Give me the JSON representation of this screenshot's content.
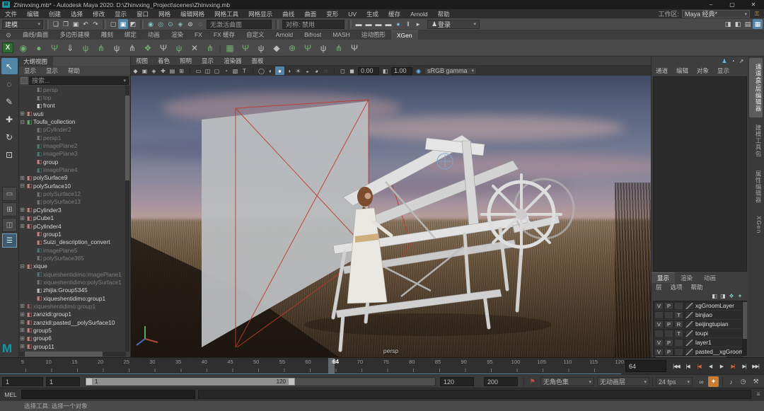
{
  "window": {
    "logo": "M",
    "title": "Zhinvxing.mb* - Autodesk Maya 2020: D:\\Zhinvxing_Project\\scenes\\Zhinvxing.mb",
    "controls": [
      {
        "g": "–"
      },
      {
        "g": "▢"
      },
      {
        "g": "✕"
      }
    ],
    "workspace_label": "工作区:",
    "workspace_value": "Maya 经典*",
    "caret": "▾",
    "lock_icon": "⚿"
  },
  "menubar": {
    "items": [
      {
        "label": "文件"
      },
      {
        "label": "编辑"
      },
      {
        "label": "创建"
      },
      {
        "label": "选择"
      },
      {
        "label": "修改"
      },
      {
        "label": "显示"
      },
      {
        "label": "窗口"
      },
      {
        "label": "网格"
      },
      {
        "label": "编辑网格"
      },
      {
        "label": "网格工具"
      },
      {
        "label": "网格显示"
      },
      {
        "label": "曲线"
      },
      {
        "label": "曲面"
      },
      {
        "label": "变形"
      },
      {
        "label": "UV"
      },
      {
        "label": "生成"
      },
      {
        "label": "缓存"
      },
      {
        "label": "Arnold"
      },
      {
        "label": "帮助"
      }
    ]
  },
  "statusline": {
    "mode": "建模",
    "file_icons": [
      {
        "g": "❏"
      },
      {
        "g": "❐"
      },
      {
        "g": "▣"
      },
      {
        "g": "↶"
      },
      {
        "g": "↷"
      }
    ],
    "selmask_icons": [
      {
        "g": "▢"
      },
      {
        "g": "▣",
        "cls": "act"
      },
      {
        "g": "◩"
      }
    ],
    "snap_icons": [
      {
        "g": "◉",
        "cls": "tl"
      },
      {
        "g": "◎",
        "cls": "tl"
      },
      {
        "g": "⊙",
        "cls": "tl"
      },
      {
        "g": "◈",
        "cls": "tl"
      },
      {
        "g": "⊚"
      },
      {
        "g": "◌"
      }
    ],
    "no_live_surface": "无激活曲面",
    "symmetry": "对称: 禁用",
    "render_icons": [
      {
        "g": "▬"
      },
      {
        "g": "▬"
      },
      {
        "g": "▬"
      },
      {
        "g": "▬"
      },
      {
        "g": "●",
        "cls": "blu"
      },
      {
        "g": "‖"
      },
      {
        "g": "▸"
      }
    ],
    "login_icon": "♟",
    "login": "登录",
    "right_toggles": [
      {
        "g": "◨"
      },
      {
        "g": "◧"
      },
      {
        "g": "▤"
      },
      {
        "g": "▦",
        "cls": "act"
      }
    ]
  },
  "shelf": {
    "gear": "⚙",
    "tabs": [
      {
        "label": "曲线/曲面"
      },
      {
        "label": "多边形建模"
      },
      {
        "label": "雕刻"
      },
      {
        "label": "绑定"
      },
      {
        "label": "动画"
      },
      {
        "label": "渲染"
      },
      {
        "label": "FX"
      },
      {
        "label": "FX 缓存"
      },
      {
        "label": "自定义"
      },
      {
        "label": "Arnold"
      },
      {
        "label": "Bifrost"
      },
      {
        "label": "MASH"
      },
      {
        "label": "运动图形"
      },
      {
        "label": "XGen",
        "cls": "act"
      }
    ],
    "icons": [
      {
        "g": "X",
        "cls": "xgx"
      },
      {
        "g": "◉",
        "cls": "grn"
      },
      {
        "g": "●",
        "cls": "grn"
      },
      {
        "g": "Ψ",
        "cls": "grn"
      },
      {
        "g": "⇓",
        "cls": "gry"
      },
      {
        "g": "ψ",
        "cls": "grn"
      },
      {
        "g": "⋔",
        "cls": "grn"
      },
      {
        "g": "ψ",
        "cls": "gry"
      },
      {
        "g": "⋔",
        "cls": "gry"
      },
      {
        "g": "❖",
        "cls": "grn"
      },
      {
        "g": "Ψ",
        "cls": "gry"
      },
      {
        "g": "ψ",
        "cls": "grn"
      },
      {
        "g": "✕",
        "cls": "gry"
      },
      {
        "g": "⋔",
        "cls": "grn"
      },
      {
        "g": "|",
        "cls": "sp"
      },
      {
        "g": "▦",
        "cls": "grn"
      },
      {
        "g": "Ψ",
        "cls": "grn"
      },
      {
        "g": "ψ",
        "cls": "gry"
      },
      {
        "g": "◆",
        "cls": "gry"
      },
      {
        "g": "⊕",
        "cls": "grn"
      },
      {
        "g": "Ψ",
        "cls": "grn"
      },
      {
        "g": "ψ",
        "cls": "gry"
      },
      {
        "g": "⋔",
        "cls": "grn"
      },
      {
        "g": "Ψ",
        "cls": "gry"
      }
    ]
  },
  "toolbox": {
    "tools": [
      {
        "g": "↖",
        "cls": "act"
      },
      {
        "g": "◌"
      },
      {
        "g": "✎"
      },
      {
        "g": "✚"
      },
      {
        "g": "↻"
      },
      {
        "g": "⊡"
      }
    ],
    "layouts": [
      {
        "g": "▭"
      },
      {
        "g": "⊞"
      },
      {
        "g": "◫"
      },
      {
        "g": "☰",
        "cls": "act"
      }
    ]
  },
  "outliner": {
    "title": "大纲视图",
    "menus": [
      {
        "label": "显示"
      },
      {
        "label": "显示"
      },
      {
        "label": "帮助"
      }
    ],
    "search_placeholder": "搜索...",
    "items": [
      {
        "label": "persp",
        "icon": "icon-cam",
        "cls": "lvl1 dim",
        "exp": ""
      },
      {
        "label": "top",
        "icon": "icon-cam",
        "cls": "lvl1 dim",
        "exp": ""
      },
      {
        "label": "front",
        "icon": "icon-cam",
        "cls": "lvl1",
        "exp": ""
      },
      {
        "label": "wuti",
        "icon": "icon-poly",
        "cls": "",
        "exp": "⊞"
      },
      {
        "label": "Toufa_collection",
        "icon": "icon-xgen",
        "cls": "",
        "exp": "⊟"
      },
      {
        "label": "pCylinder2",
        "icon": "icon-mesh",
        "cls": "lvl1 dim",
        "exp": ""
      },
      {
        "label": "persp1",
        "icon": "icon-cam",
        "cls": "lvl1 dim",
        "exp": ""
      },
      {
        "label": "imagePlane2",
        "icon": "icon-img",
        "cls": "lvl1 dim",
        "exp": ""
      },
      {
        "label": "imagePlane3",
        "icon": "icon-img",
        "cls": "lvl1 dim",
        "exp": ""
      },
      {
        "label": "group",
        "icon": "icon-poly",
        "cls": "lvl1",
        "exp": ""
      },
      {
        "label": "imagePlane4",
        "icon": "icon-img",
        "cls": "lvl1 dim",
        "exp": ""
      },
      {
        "label": "polySurface9",
        "icon": "icon-poly",
        "cls": "",
        "exp": "⊞"
      },
      {
        "label": "polySurface10",
        "icon": "icon-poly",
        "cls": "",
        "exp": "⊟"
      },
      {
        "label": "polySurface12",
        "icon": "icon-mesh",
        "cls": "lvl1 dim",
        "exp": ""
      },
      {
        "label": "polySurface13",
        "icon": "icon-mesh",
        "cls": "lvl1 dim",
        "exp": ""
      },
      {
        "label": "pCylinder3",
        "icon": "icon-poly",
        "cls": "",
        "exp": "⊞"
      },
      {
        "label": "pCube1",
        "icon": "icon-poly",
        "cls": "",
        "exp": "⊞"
      },
      {
        "label": "pCylinder4",
        "icon": "icon-poly",
        "cls": "",
        "exp": "⊞"
      },
      {
        "label": "group1",
        "icon": "icon-poly",
        "cls": "lvl1",
        "exp": ""
      },
      {
        "label": "Suizi_description_convert",
        "icon": "icon-poly",
        "cls": "lvl1",
        "exp": ""
      },
      {
        "label": "imagePlane5",
        "icon": "icon-img",
        "cls": "lvl1 dim",
        "exp": ""
      },
      {
        "label": "polySurface365",
        "icon": "icon-mesh",
        "cls": "lvl1 dim",
        "exp": ""
      },
      {
        "label": "xique",
        "icon": "icon-poly",
        "cls": "",
        "exp": "⊟"
      },
      {
        "label": "xiqueshentidimo:imagePlane1",
        "icon": "icon-img",
        "cls": "lvl1 dim",
        "exp": ""
      },
      {
        "label": "xiqueshentidimo:polySurface1",
        "icon": "icon-mesh",
        "cls": "lvl1 dim",
        "exp": ""
      },
      {
        "label": "zhijia:Group5345",
        "icon": "icon-mesh",
        "cls": "lvl1",
        "exp": ""
      },
      {
        "label": "xiqueshentidimo:group1",
        "icon": "icon-poly",
        "cls": "lvl1",
        "exp": ""
      },
      {
        "label": "xiqueshentidimo:group1",
        "icon": "icon-poly",
        "cls": "dim",
        "exp": "⊞"
      },
      {
        "label": "zanzidi:group1",
        "icon": "icon-poly",
        "cls": "",
        "exp": "⊞"
      },
      {
        "label": "zanzidi:pasted__polySurface10",
        "icon": "icon-poly",
        "cls": "",
        "exp": "⊞"
      },
      {
        "label": "group5",
        "icon": "icon-poly",
        "cls": "",
        "exp": "⊞"
      },
      {
        "label": "group6",
        "icon": "icon-poly",
        "cls": "",
        "exp": "⊞"
      },
      {
        "label": "group11",
        "icon": "icon-poly",
        "cls": "",
        "exp": "⊞"
      }
    ]
  },
  "viewport": {
    "menus": [
      {
        "label": "视图"
      },
      {
        "label": "着色"
      },
      {
        "label": "照明"
      },
      {
        "label": "显示"
      },
      {
        "label": "渲染器"
      },
      {
        "label": "面板"
      }
    ],
    "toolbar_icons": [
      {
        "g": "◆"
      },
      {
        "g": "▣"
      },
      {
        "g": "◈"
      },
      {
        "g": "✚"
      },
      {
        "g": "▤"
      },
      {
        "g": "⊞"
      },
      {
        "g": "|",
        "cls": "sep"
      },
      {
        "g": "▭"
      },
      {
        "g": "◫"
      },
      {
        "g": "▢"
      },
      {
        "g": "◔"
      },
      {
        "g": "▧"
      },
      {
        "g": "T"
      },
      {
        "g": "|",
        "cls": "sep"
      },
      {
        "g": "◯"
      },
      {
        "g": "◐"
      },
      {
        "g": "●",
        "cls": "act"
      },
      {
        "g": "◑"
      },
      {
        "g": "☀"
      },
      {
        "g": "◒"
      },
      {
        "g": "◕"
      },
      {
        "g": "◌"
      },
      {
        "g": "|",
        "cls": "sep"
      },
      {
        "g": "◻"
      },
      {
        "g": "◼"
      }
    ],
    "exposure": "0.00",
    "exposure_icon": "◧",
    "gamma": "1.00",
    "gamma_icon": "◉",
    "colorspace": "sRGB gamma",
    "camera_label": "persp"
  },
  "right_panel": {
    "top_icons": [
      {
        "g": "♟",
        "cls": "blu"
      },
      {
        "g": "◔"
      },
      {
        "g": "↗"
      }
    ],
    "channel_menus": [
      {
        "label": "通道"
      },
      {
        "label": "编辑"
      },
      {
        "label": "对象"
      },
      {
        "label": "显示"
      }
    ],
    "layer_editor": {
      "tabs": [
        {
          "label": "显示",
          "cls": "act"
        },
        {
          "label": "渲染"
        },
        {
          "label": "动画"
        }
      ],
      "menus": [
        {
          "label": "层"
        },
        {
          "label": "选项"
        },
        {
          "label": "帮助"
        }
      ],
      "icons": [
        {
          "g": "◧"
        },
        {
          "g": "◨"
        },
        {
          "g": "❖",
          "cls": "tl"
        },
        {
          "g": "✦",
          "cls": "tl"
        }
      ],
      "layers": [
        {
          "a": "V",
          "b": "P",
          "c": "",
          "name": "xgGroomLayer"
        },
        {
          "a": "",
          "b": "",
          "c": "T",
          "name": "binjiao"
        },
        {
          "a": "V",
          "b": "P",
          "c": "R",
          "name": "beijingtupian"
        },
        {
          "a": "",
          "b": "",
          "c": "T",
          "name": "toupi"
        },
        {
          "a": "V",
          "b": "P",
          "c": "",
          "name": "layer1"
        },
        {
          "a": "V",
          "b": "P",
          "c": "",
          "name": "pasted__xgGroomLayer"
        }
      ]
    },
    "vertical_tabs": [
      {
        "label": "通道盒/层编辑器",
        "cls": "act"
      },
      {
        "label": "建模工具包"
      },
      {
        "label": "属性编辑器"
      },
      {
        "label": "XGen"
      }
    ]
  },
  "timeline": {
    "ticks": [
      {
        "t": "5"
      },
      {
        "t": "10"
      },
      {
        "t": "15"
      },
      {
        "t": "20"
      },
      {
        "t": "25"
      },
      {
        "t": "30"
      },
      {
        "t": "35"
      },
      {
        "t": "40"
      },
      {
        "t": "45"
      },
      {
        "t": "50"
      },
      {
        "t": "55"
      },
      {
        "t": "60"
      },
      {
        "t": "65"
      },
      {
        "t": "70"
      },
      {
        "t": "75"
      },
      {
        "t": "80"
      },
      {
        "t": "85"
      },
      {
        "t": "90"
      },
      {
        "t": "95"
      },
      {
        "t": "100"
      },
      {
        "t": "105"
      },
      {
        "t": "110"
      },
      {
        "t": "115"
      },
      {
        "t": "120"
      }
    ],
    "current_frame": "64",
    "playback": [
      {
        "g": "|◀◀"
      },
      {
        "g": "|◀"
      },
      {
        "g": "|◀",
        "cls": "key"
      },
      {
        "g": "◀"
      },
      {
        "g": "▶"
      },
      {
        "g": "▶|",
        "cls": "key"
      },
      {
        "g": "▶|"
      },
      {
        "g": "▶▶|"
      }
    ]
  },
  "range_slider": {
    "anim_start": "1",
    "playback_start": "1",
    "slider_start_label": "1",
    "slider_end_label": "120",
    "playback_end": "120",
    "anim_end": "200",
    "charset_icon": "⚑",
    "character_set": "无角色集",
    "anim_layer": "无动画层",
    "fps": "24 fps",
    "loop_icon": "∞",
    "autokey_icon": "✦",
    "audio_icon": "♪",
    "clock_icon": "◷",
    "tool_icon": "⚒"
  },
  "command_line": {
    "label": "MEL",
    "input_value": "",
    "side_icon": "≡",
    "help": "选择工具: 选择一个对象"
  },
  "colors": {
    "accent_blue": "#5285a6",
    "xgen_green": "#6fae6f",
    "timeline_line": "#5d8296",
    "autokey_orange": "#c87d33",
    "maya_teal": "#0f9ba8"
  }
}
